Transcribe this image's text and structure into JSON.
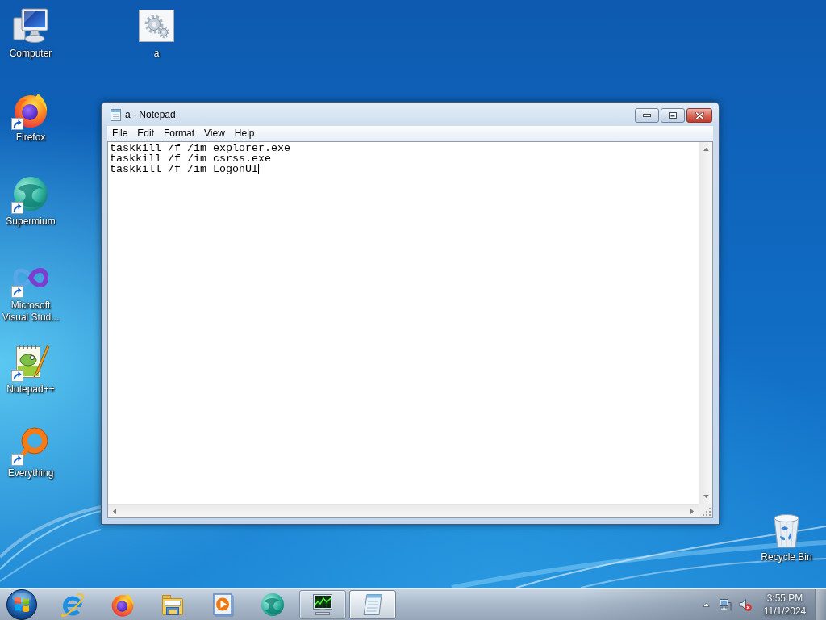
{
  "desktop": {
    "icons": [
      {
        "label": "Computer",
        "kind": "computer",
        "shortcut": false
      },
      {
        "label": "a",
        "kind": "settings-file",
        "shortcut": false
      },
      {
        "label": "Firefox",
        "kind": "flame-globe",
        "shortcut": true
      },
      {
        "label": "Supermium",
        "kind": "globe",
        "shortcut": true
      },
      {
        "label": "Microsoft Visual Stud...",
        "kind": "infinity",
        "shortcut": true
      },
      {
        "label": "Notepad++",
        "kind": "chameleon-notepad",
        "shortcut": true
      },
      {
        "label": "Everything",
        "kind": "ring",
        "shortcut": true
      },
      {
        "label": "Recycle Bin",
        "kind": "bin",
        "shortcut": false
      }
    ]
  },
  "window": {
    "title": "a - Notepad",
    "menu": [
      {
        "label": "File"
      },
      {
        "label": "Edit"
      },
      {
        "label": "Format"
      },
      {
        "label": "View"
      },
      {
        "label": "Help"
      }
    ],
    "document": {
      "lines": [
        "taskkill /f /im explorer.exe",
        "taskkill /f /im csrss.exe",
        "taskkill /f /im LogonUI"
      ],
      "caret": true
    }
  },
  "taskbar": {
    "buttons": [
      {
        "kind": "e-logo",
        "running": false,
        "selected": false
      },
      {
        "kind": "flame-globe",
        "running": false,
        "selected": false
      },
      {
        "kind": "folder",
        "running": false,
        "selected": false
      },
      {
        "kind": "play",
        "running": false,
        "selected": false
      },
      {
        "kind": "globe",
        "running": false,
        "selected": false
      },
      {
        "kind": "monitor-graph",
        "running": true,
        "selected": false
      },
      {
        "kind": "notepad",
        "running": true,
        "selected": true
      }
    ],
    "tray": {
      "volume_muted": true,
      "time": "3:55 PM",
      "date": "11/1/2024"
    }
  }
}
